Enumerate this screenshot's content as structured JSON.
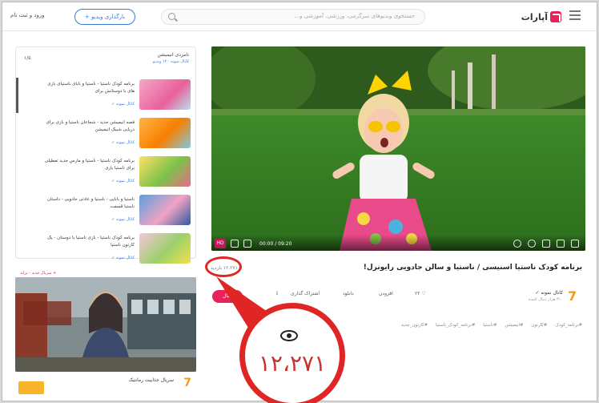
{
  "header": {
    "logo_text": "آپارات",
    "search_placeholder": "جستجوی ویدیوهای سرگرمی، ورزشی، آموزشی و...",
    "upload_label": "بارگذاری ویدیو +",
    "login_label": "ورود و ثبت نام"
  },
  "sidebar": {
    "heading": "نامزدی انیمیشن",
    "subheading": "کانال نمونه · ۱۲ ویدیو",
    "count": "۱/۵",
    "items": [
      {
        "title": "برنامه کودک ناستیا - ناستیا و بابای ناستیای بازی های با دوستانش برای",
        "channel": "کانال نمونه ✓",
        "thumb": "pink"
      },
      {
        "title": "قصه انیمیشن جدید - شجاعان ناستیا و بازی برای دریایی شیبک انیمیشن",
        "channel": "کانال نمونه ✓",
        "thumb": "orange"
      },
      {
        "title": "برنامه کودک ناستیا - ناستیا و مارس جدید تعطیلی برای ناستیا بازی",
        "channel": "کانال نمونه ✓",
        "thumb": "park"
      },
      {
        "title": "ناستیا و بابایی - ناستیا و عادتی جادویی - داستان ناستیا قسمت",
        "channel": "کانال نمونه ✓",
        "thumb": "blue"
      },
      {
        "title": "برنامه کودک ناستیا - بازی ناستیا با دوستان - یک کارتون ناستیا",
        "channel": "کانال نمونه ✓",
        "thumb": "pink2"
      }
    ]
  },
  "ad": {
    "label": "+ سریال جدید - ترانه",
    "caption": "سریال جذابیت رمانتیک"
  },
  "player": {
    "quality": "HD",
    "time": "00:00 / 09:20"
  },
  "video": {
    "title": "برنامه کودک ناستیا اسنیسی / ناستیا و سالن جادویی رایونزل!",
    "views": "۱۲,۲۷۱ بازدید",
    "channel_name": "کانال نمونه ✓",
    "channel_followers": "۳۱۰ هزار دنبال کننده",
    "follow_label": "دنبال",
    "like_count": "۲۲",
    "actions": {
      "save": "افزودن",
      "download": "دانلود",
      "share": "اشتراک گذاری",
      "more": "⋮"
    },
    "tags": [
      "#برنامه_کودک",
      "#کارتون",
      "#انیمیشن",
      "#ناستیا",
      "#برنامه_کودک_ناستیا",
      "#کارتون_جدید"
    ]
  },
  "callout": {
    "value": "۱۲،۲۷۱"
  },
  "colors": {
    "accent": "#e8235a",
    "link": "#3a7bd5",
    "callout_red": "#e02525"
  }
}
